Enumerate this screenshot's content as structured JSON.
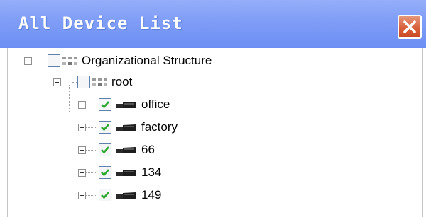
{
  "window": {
    "title": "All Device List",
    "close_icon": "close-icon"
  },
  "tree": {
    "root_node": {
      "label": "Organizational Structure",
      "expanded": true,
      "checked": false
    },
    "root_child": {
      "label": "root",
      "expanded": true,
      "checked": false
    },
    "devices": [
      {
        "label": "office",
        "expanded": false,
        "checked": true
      },
      {
        "label": "factory",
        "expanded": false,
        "checked": true
      },
      {
        "label": "66",
        "expanded": false,
        "checked": true
      },
      {
        "label": "134",
        "expanded": false,
        "checked": true
      },
      {
        "label": "149",
        "expanded": false,
        "checked": true
      }
    ]
  },
  "colors": {
    "titlebar": "#7f9df7",
    "close_button": "#d9603c",
    "checkmark": "#2fa82f"
  }
}
